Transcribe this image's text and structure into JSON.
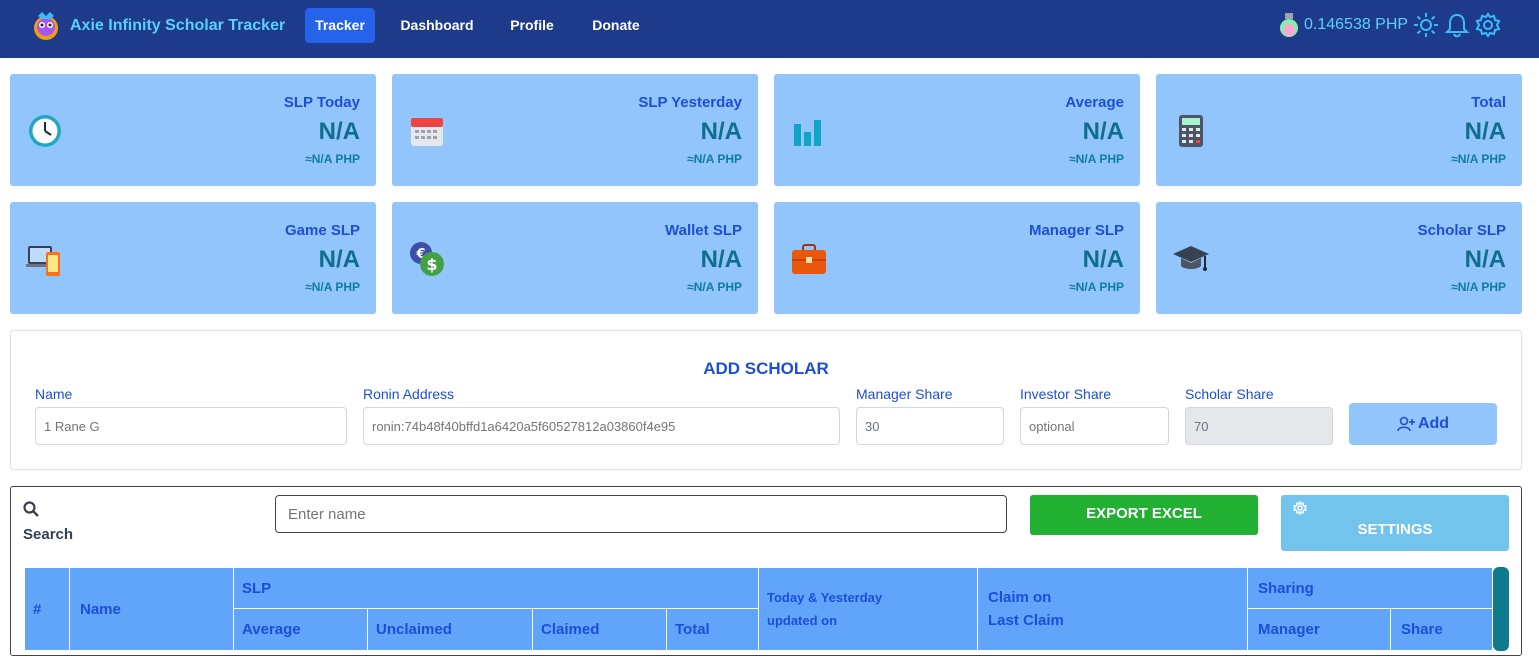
{
  "app": {
    "title": "Axie Infinity Scholar Tracker",
    "nav": [
      {
        "label": "Tracker",
        "active": true
      },
      {
        "label": "Dashboard",
        "active": false
      },
      {
        "label": "Profile",
        "active": false
      },
      {
        "label": "Donate",
        "active": false
      }
    ],
    "slp_price": "0.146538 PHP",
    "icons": [
      "slp-potion-icon",
      "sun-icon",
      "bell-icon",
      "gear-icon"
    ]
  },
  "stats": [
    {
      "label": "SLP Today",
      "value": "N/A",
      "php": "≈N/A PHP",
      "icon": "clock-icon"
    },
    {
      "label": "SLP Yesterday",
      "value": "N/A",
      "php": "≈N/A PHP",
      "icon": "calendar-icon"
    },
    {
      "label": "Average",
      "value": "N/A",
      "php": "≈N/A PHP",
      "icon": "bar-chart-icon"
    },
    {
      "label": "Total",
      "value": "N/A",
      "php": "≈N/A PHP",
      "icon": "calculator-icon"
    },
    {
      "label": "Game SLP",
      "value": "N/A",
      "php": "≈N/A PHP",
      "icon": "devices-icon"
    },
    {
      "label": "Wallet SLP",
      "value": "N/A",
      "php": "≈N/A PHP",
      "icon": "currency-exchange-icon"
    },
    {
      "label": "Manager SLP",
      "value": "N/A",
      "php": "≈N/A PHP",
      "icon": "briefcase-icon"
    },
    {
      "label": "Scholar SLP",
      "value": "N/A",
      "php": "≈N/A PHP",
      "icon": "graduation-cap-icon"
    }
  ],
  "add_scholar": {
    "title": "ADD SCHOLAR",
    "fields": {
      "name": {
        "label": "Name",
        "placeholder": "1 Rane G"
      },
      "ronin": {
        "label": "Ronin Address",
        "placeholder": "ronin:74b48f40bffd1a6420a5f60527812a03860f4e95"
      },
      "manager": {
        "label": "Manager Share",
        "value": "30"
      },
      "investor": {
        "label": "Investor Share",
        "placeholder": "optional"
      },
      "scholar": {
        "label": "Scholar Share",
        "value": "70"
      }
    },
    "add_label": "Add"
  },
  "list": {
    "search_label": "Search",
    "search_placeholder": "Enter name",
    "export_label": "EXPORT EXCEL",
    "settings_label": "SETTINGS",
    "headers": {
      "num": "#",
      "name": "Name",
      "slp": "SLP",
      "average": "Average",
      "unclaimed": "Unclaimed",
      "claimed": "Claimed",
      "total": "Total",
      "today_yesterday_1": "Today & Yesterday",
      "today_yesterday_2": "updated on",
      "claim_on": "Claim on",
      "last_claim": "Last Claim",
      "sharing": "Sharing",
      "manager": "Manager",
      "share": "Share"
    }
  },
  "colors": {
    "navbar": "#1e3a8a",
    "card": "#93c5fd",
    "accent": "#1d4ed8",
    "export": "#22b033",
    "settings": "#73c4ec"
  }
}
